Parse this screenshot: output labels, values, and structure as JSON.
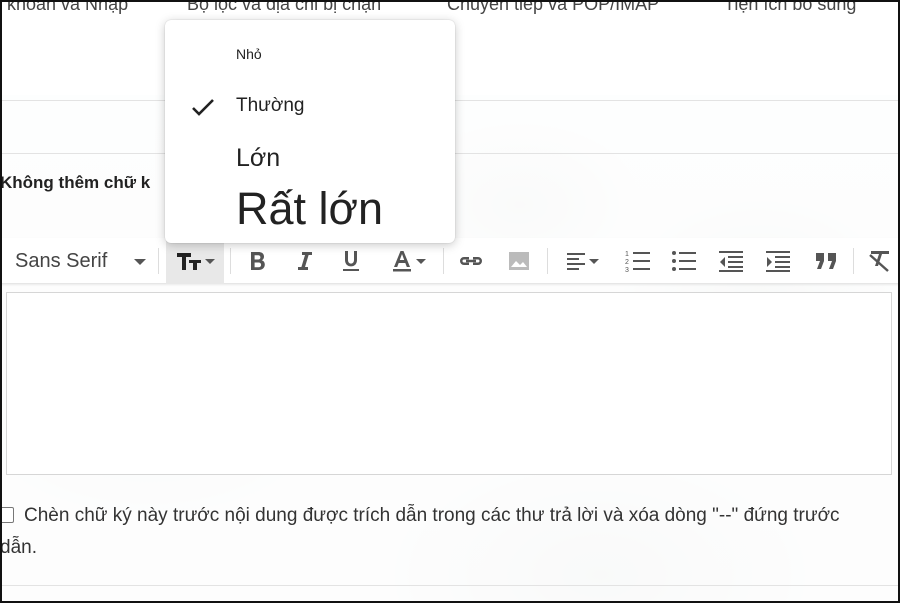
{
  "settings_tabs": [
    "i khoản và Nhập",
    "Bộ lọc và địa chỉ bị chặn",
    "Chuyển tiếp và POP/IMAP",
    "Tiện ích bổ sung"
  ],
  "signature": {
    "label": "Không thêm chữ k"
  },
  "size_menu": {
    "items": [
      "Nhỏ",
      "Thường",
      "Lớn",
      "Rất lớn"
    ],
    "selected": "Thường"
  },
  "toolbar": {
    "font_family": "Sans Serif",
    "buttons": [
      "text-size-icon",
      "bold-icon",
      "italic-icon",
      "underline-icon",
      "text-color-icon",
      "link-icon",
      "image-icon",
      "align-icon",
      "numbered-list-icon",
      "bulleted-list-icon",
      "indent-less-icon",
      "indent-more-icon",
      "quote-icon",
      "remove-formatting-icon"
    ]
  },
  "editor": {
    "value": ""
  },
  "insert_before_quote": {
    "checked": false,
    "label_line1": "Chèn chữ ký này trước nội dung được trích dẫn trong các thư trả lời và xóa dòng \"--\" đứng trước",
    "label_line2": "dẫn."
  },
  "colors": {
    "menu_bg": "#ffffff",
    "active_button_bg": "#e8e8e8",
    "icon_gray": "#555555"
  }
}
